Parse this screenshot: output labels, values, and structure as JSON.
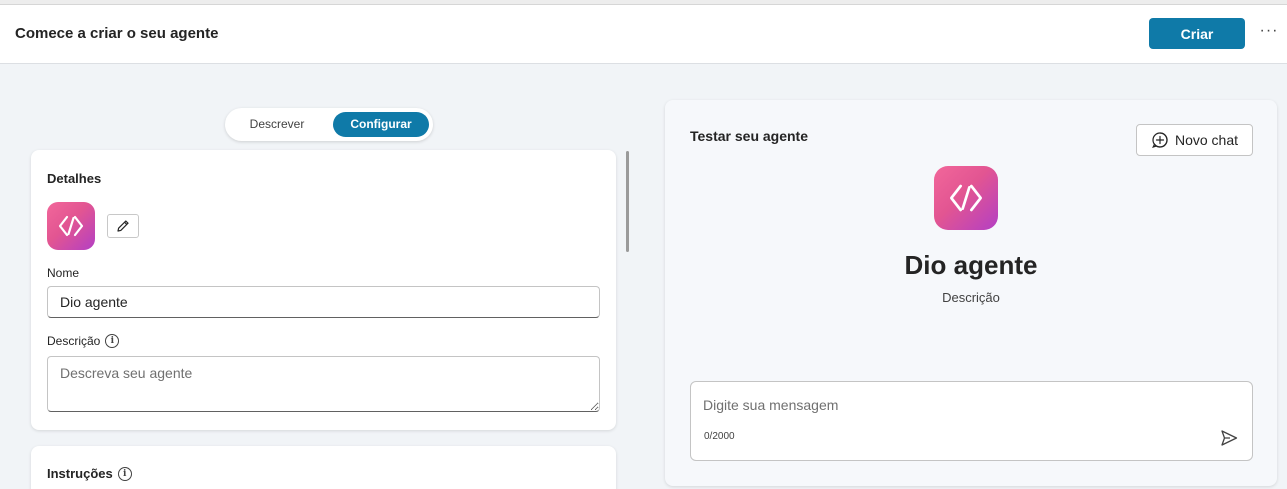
{
  "header": {
    "title": "Comece a criar o seu agente",
    "create_label": "Criar",
    "more_label": "···"
  },
  "mode_toggle": {
    "options": [
      "Descrever",
      "Configurar"
    ],
    "selected": "Configurar"
  },
  "details": {
    "title": "Detalhes",
    "name_label": "Nome",
    "name_value": "Dio agente",
    "description_label": "Descrição",
    "description_placeholder": "Descreva seu agente",
    "icons": {
      "agent": "code-brackets-icon",
      "edit": "pencil-icon",
      "info": "info-icon"
    }
  },
  "instructions": {
    "title": "Instruções"
  },
  "test_panel": {
    "title": "Testar seu agente",
    "new_chat_label": "Novo chat",
    "agent_name": "Dio agente",
    "agent_description": "Descrição",
    "message_placeholder": "Digite sua mensagem",
    "char_count": "0/2000"
  },
  "colors": {
    "accent": "#0f7aa8",
    "icon_gradient_start": "#f2679a",
    "icon_gradient_end": "#b33fc4"
  }
}
